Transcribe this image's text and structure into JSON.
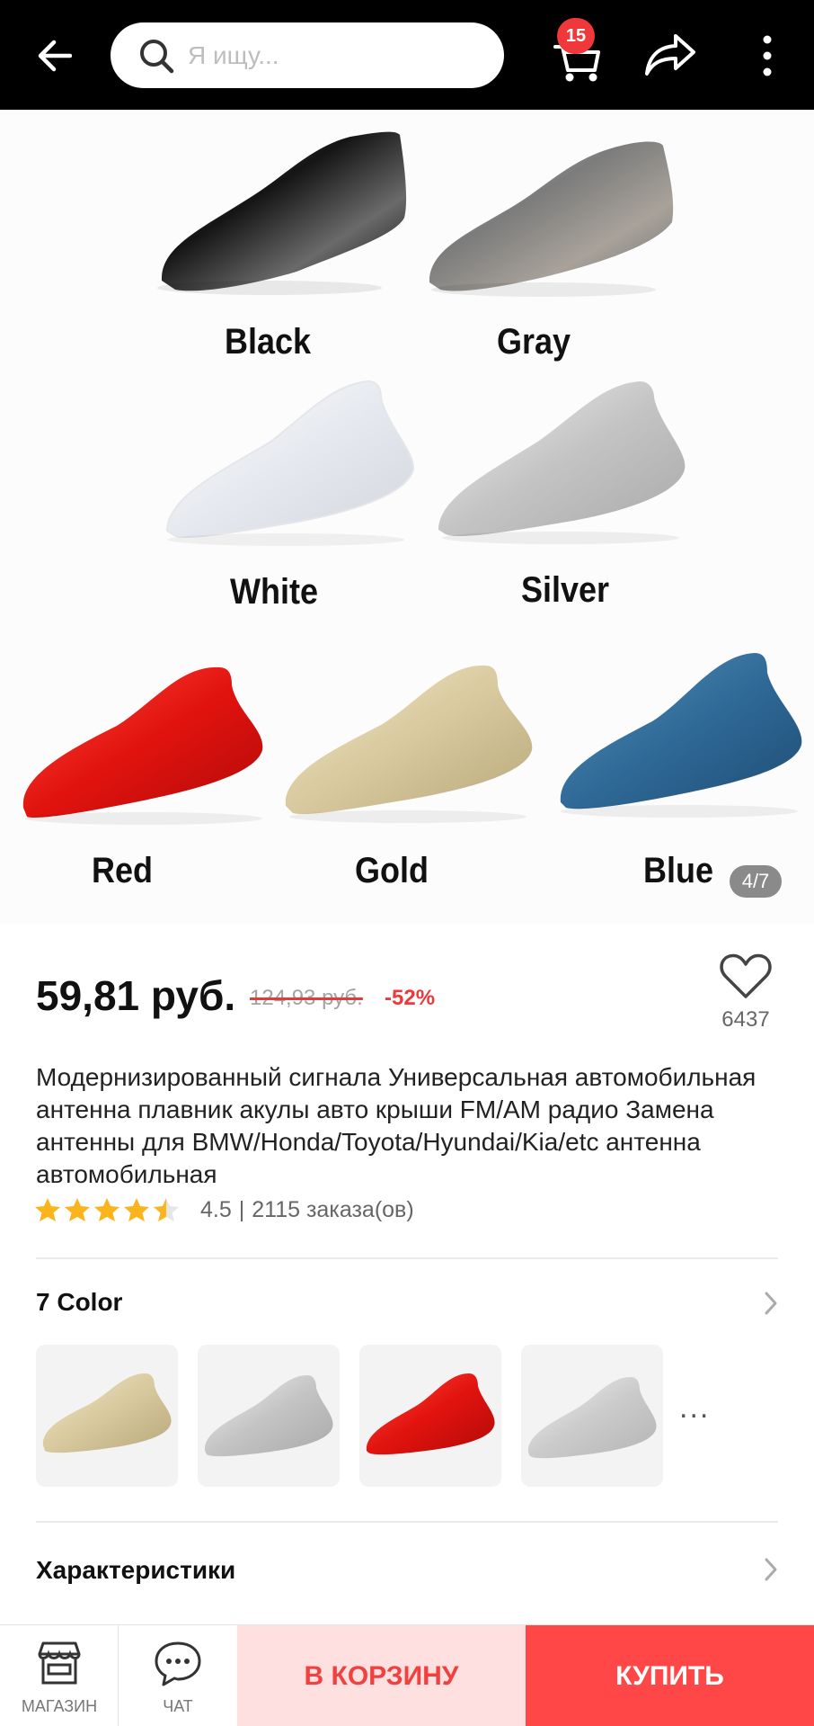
{
  "search": {
    "placeholder": "Я ищу..."
  },
  "header": {
    "cart_count": "15"
  },
  "gallery": {
    "variants": [
      "Black",
      "Gray",
      "White",
      "Silver",
      "Red",
      "Gold",
      "Blue"
    ],
    "counter": "4/7"
  },
  "product": {
    "price": "59,81 руб.",
    "old_price": "124,93 руб.",
    "discount": "-52%",
    "wishlist_count": "6437",
    "title": "Модернизированный сигнала Универсальная автомобильная антенна плавник акулы авто крыши FM/AM радио Замена антенны для BMW/Honda/Toyota/Hyundai/Kia/etc антенна автомобильная",
    "rating": "4.5",
    "orders": "2115 заказа(ов)",
    "rating_stars": 4.5
  },
  "options": {
    "title": "7 Color",
    "thumbnails": [
      "Gold",
      "Silver",
      "Red",
      "White"
    ],
    "more": "..."
  },
  "specs": {
    "title": "Характеристики"
  },
  "bottom_bar": {
    "store_label": "МАГАЗИН",
    "chat_label": "ЧАТ",
    "add_to_cart": "В КОРЗИНУ",
    "buy": "КУПИТЬ"
  },
  "colors": {
    "accent": "#ff4747",
    "accent_light": "#fde0df",
    "star": "#fbb41b"
  }
}
